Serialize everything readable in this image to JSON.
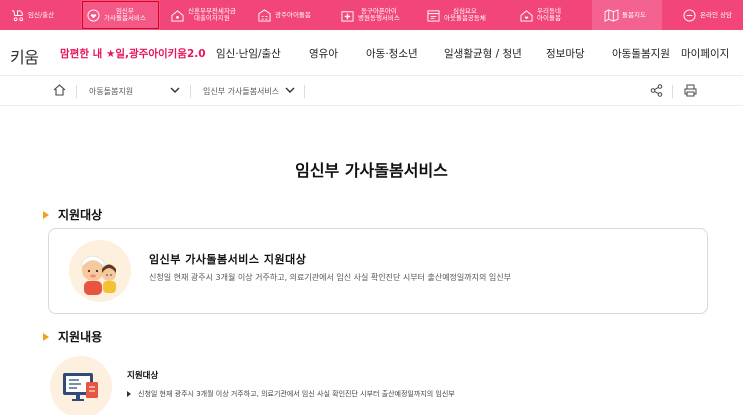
{
  "quickbar": {
    "items": [
      {
        "label": "임신/출산",
        "icon": "baby-carriage-icon"
      },
      {
        "label": "임신부\n가사돌봄서비스",
        "icon": "heart-hands-icon",
        "active": true
      },
      {
        "label": "신혼부부전세자금\n대출이자지원",
        "icon": "house-key-icon"
      },
      {
        "label": "광주아이돌봄",
        "icon": "building-icon"
      },
      {
        "label": "동구아픈아이\n병원동행서비스",
        "icon": "hospital-icon"
      },
      {
        "label": "심심요오\n아웃돌봄공동체",
        "icon": "calendar-icon"
      },
      {
        "label": "우리동네\n아이돌봄",
        "icon": "house-heart-icon"
      },
      {
        "label": "돌봄지도",
        "icon": "map-icon"
      },
      {
        "label": "온라인 상담",
        "icon": "chat-icon"
      }
    ]
  },
  "nav": {
    "logo": "키움",
    "brand": "맘편한 내 ★일,광주아이키움2.0",
    "items": [
      "임신·난임/출산",
      "영유아",
      "아동·청소년",
      "일생활균형 / 청년",
      "정보마당",
      "아동돌봄지원",
      "마이페이지"
    ]
  },
  "breadcrumb": {
    "level1": "아동돌봄지원",
    "level2": "임신부 가사돌봄서비스"
  },
  "page": {
    "title": "임신부 가사돌봄서비스"
  },
  "sections": {
    "target_heading": "지원대상",
    "content_heading": "지원내용"
  },
  "card": {
    "title": "임신부 가사돌봄서비스 지원대상",
    "desc": "신청일 현재 광주시 3개월 이상 거주하고, 의료기관에서 임신 사실 확인진단 시부터 출산예정일까지의 임신부"
  },
  "support": {
    "title": "지원대상",
    "bullet": "신청일 현재 광주시 3개월 이상 거주하고, 의료기관에서 임신 사실 확인진단 시부터 출산예정일까지의 임신부"
  },
  "colors": {
    "brand_pink": "#f2467a",
    "active_outline": "#e0001b",
    "accent_orange": "#f2a11e"
  }
}
